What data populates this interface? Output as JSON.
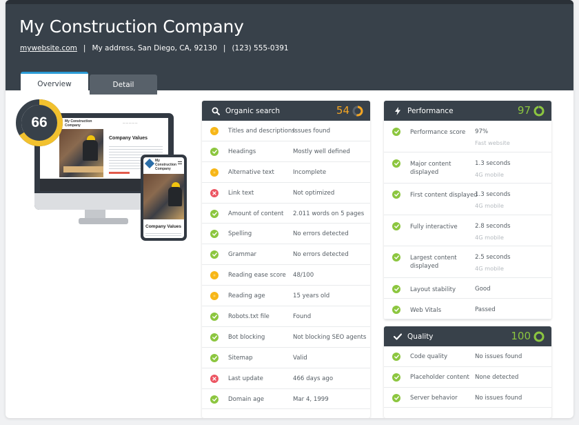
{
  "company": {
    "name": "My Construction Company",
    "website": "mywebsite.com",
    "address": "My address, San Diego, CA, 92130",
    "phone": "(123) 555-0391",
    "separator": "|"
  },
  "tabs": [
    {
      "label": "Overview",
      "active": true
    },
    {
      "label": "Detail",
      "active": false
    }
  ],
  "overall_score": {
    "value": "66",
    "fraction": 0.66,
    "color": "#f2c12e"
  },
  "mockup": {
    "desktop_brand": "My Construction Company",
    "desktop_heading": "Company Values",
    "mobile_brand": "My Construction Company",
    "mobile_heading": "Company Values"
  },
  "organic": {
    "title": "Organic search",
    "icon": "search-icon",
    "score": "54",
    "fraction": 0.54,
    "color": "#f5a623",
    "rows": [
      {
        "status": "warning",
        "label": "Titles and descriptions",
        "value": "Issues found"
      },
      {
        "status": "ok",
        "label": "Headings",
        "value": "Mostly well defined"
      },
      {
        "status": "warning",
        "label": "Alternative text",
        "value": "Incomplete"
      },
      {
        "status": "error",
        "label": "Link text",
        "value": "Not optimized"
      },
      {
        "status": "ok",
        "label": "Amount of content",
        "value": "2.011 words on 5 pages"
      },
      {
        "status": "ok",
        "label": "Spelling",
        "value": "No errors detected"
      },
      {
        "status": "ok",
        "label": "Grammar",
        "value": "No errors detected"
      },
      {
        "status": "warning",
        "label": "Reading ease score",
        "value": "48/100"
      },
      {
        "status": "warning",
        "label": "Reading age",
        "value": "15 years old"
      },
      {
        "status": "ok",
        "label": "Robots.txt file",
        "value": "Found"
      },
      {
        "status": "ok",
        "label": "Bot blocking",
        "value": "Not blocking SEO agents"
      },
      {
        "status": "ok",
        "label": "Sitemap",
        "value": "Valid"
      },
      {
        "status": "error",
        "label": "Last update",
        "value": "466 days ago"
      },
      {
        "status": "ok",
        "label": "Domain age",
        "value": "Mar 4, 1999"
      }
    ]
  },
  "performance": {
    "title": "Performance",
    "icon": "lightning-icon",
    "score": "97",
    "fraction": 0.97,
    "color": "#8cc63f",
    "rows": [
      {
        "status": "ok",
        "label_lines": [
          "Performance score"
        ],
        "value": "97%",
        "sub": "Fast website"
      },
      {
        "status": "ok",
        "label_lines": [
          "Major content",
          "displayed"
        ],
        "value": "1.3 seconds",
        "sub": "4G mobile"
      },
      {
        "status": "ok",
        "label_lines": [
          "First content displayed"
        ],
        "value": "1.3 seconds",
        "sub": "4G mobile"
      },
      {
        "status": "ok",
        "label_lines": [
          "Fully interactive"
        ],
        "value": "2.8 seconds",
        "sub": "4G mobile"
      },
      {
        "status": "ok",
        "label_lines": [
          "Largest content",
          "displayed"
        ],
        "value": "2.5 seconds",
        "sub": "4G mobile"
      },
      {
        "status": "ok",
        "label_lines": [
          "Layout stability"
        ],
        "value": "Good",
        "sub": ""
      },
      {
        "status": "ok",
        "label_lines": [
          "Web Vitals"
        ],
        "value": "Passed",
        "sub": ""
      }
    ]
  },
  "quality": {
    "title": "Quality",
    "icon": "checkmark-icon",
    "score": "100",
    "fraction": 1.0,
    "color": "#8cc63f",
    "rows": [
      {
        "status": "ok",
        "label": "Code quality",
        "value": "No issues found"
      },
      {
        "status": "ok",
        "label": "Placeholder content",
        "value": "None detected"
      },
      {
        "status": "ok",
        "label": "Server behavior",
        "value": "No issues found"
      }
    ]
  }
}
